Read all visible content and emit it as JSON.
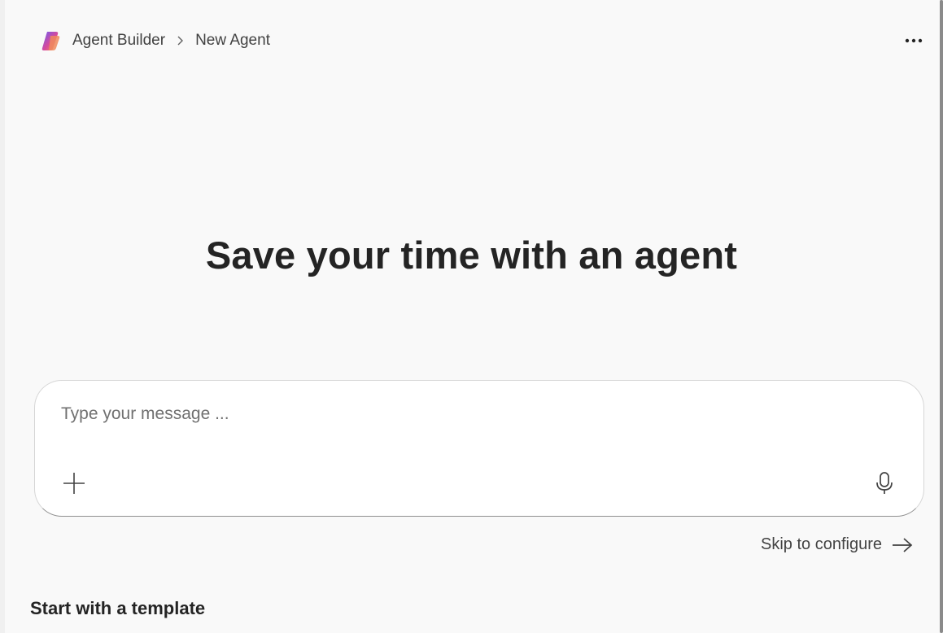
{
  "header": {
    "app_name": "Agent Builder",
    "page_name": "New Agent",
    "logo_icon": "copilot-studio-logo",
    "more_icon": "more-horizontal-icon"
  },
  "hero": {
    "title": "Save your time with an agent"
  },
  "composer": {
    "placeholder": "Type your message ...",
    "value": "",
    "add_icon": "plus-icon",
    "mic_icon": "microphone-icon"
  },
  "skip": {
    "label": "Skip to configure",
    "icon": "arrow-right-icon"
  },
  "templates": {
    "heading": "Start with a template"
  },
  "colors": {
    "background": "#f9f9f9",
    "text": "#242424",
    "logo_gradient": [
      "#7b5cf0",
      "#e0468f",
      "#f59a52"
    ]
  }
}
